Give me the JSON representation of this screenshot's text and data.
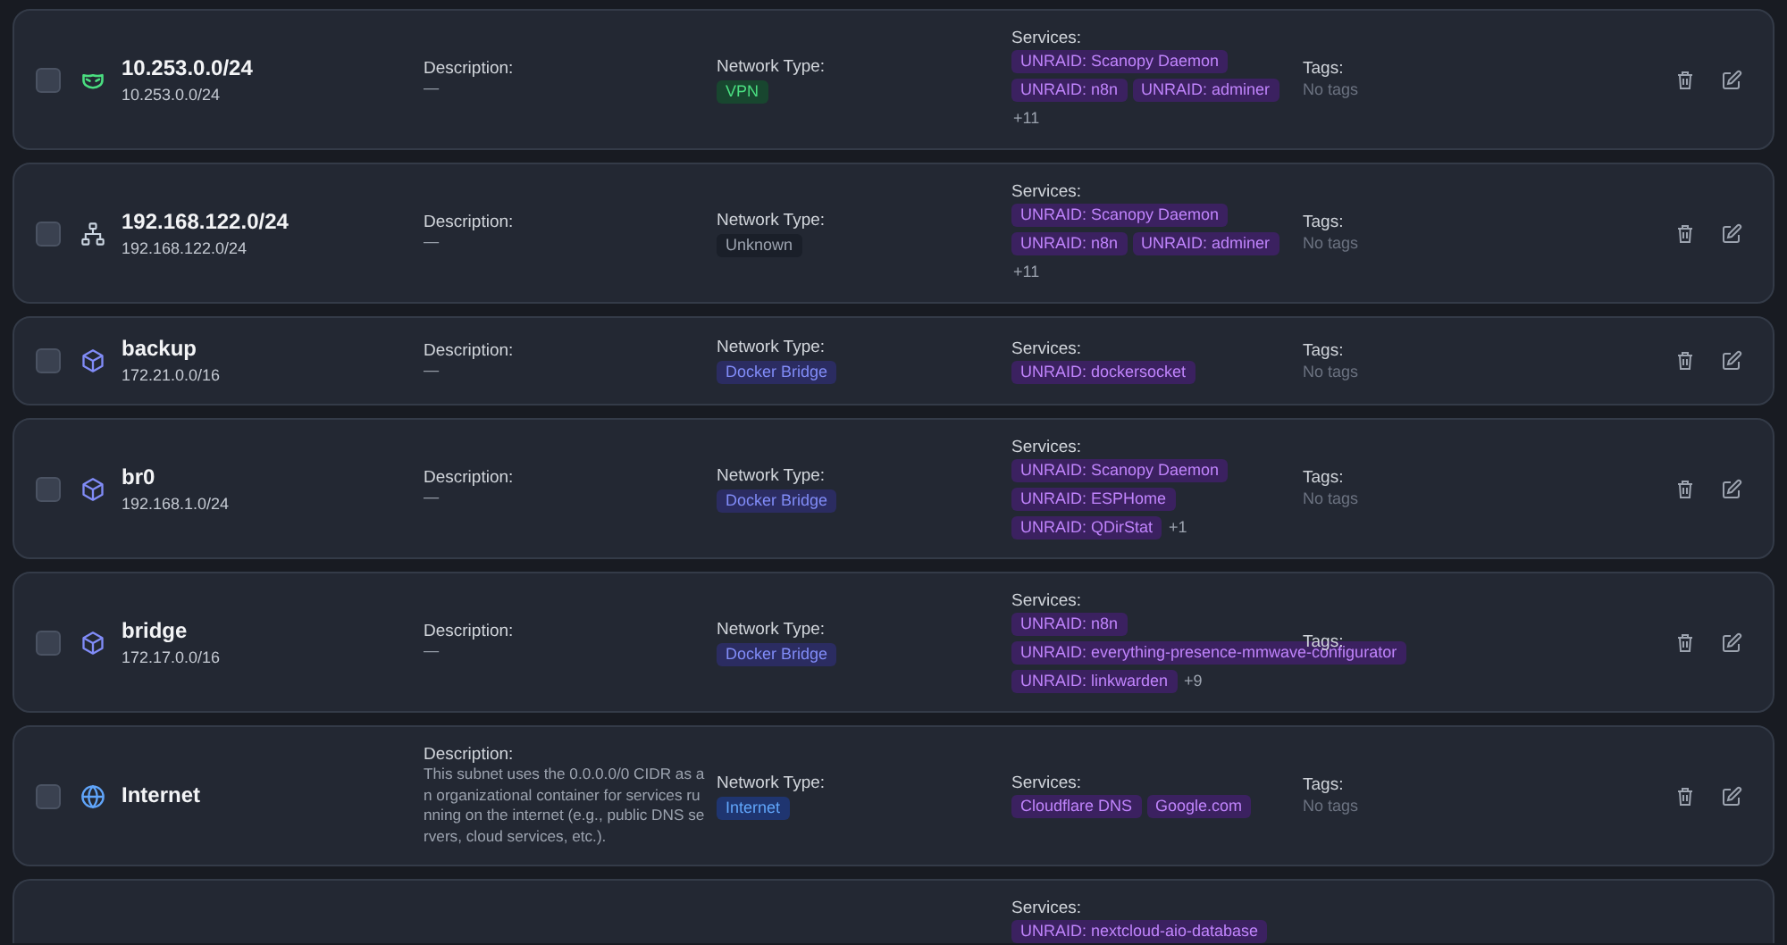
{
  "networks": [
    {
      "name": "10.253.0.0/24",
      "subnet": "10.253.0.0/24",
      "checked": false,
      "description_label": "Description:",
      "description": "—",
      "type_label": "Network Type:",
      "network_type": {
        "label": "VPN",
        "kind": "vpn"
      },
      "services_label": "Services:",
      "services": [
        "UNRAID: Scanopy Daemon",
        "UNRAID: n8n",
        "UNRAID: adminer"
      ],
      "more": "+11",
      "tags_label": "Tags:",
      "tags": "No tags"
    },
    {
      "name": "192.168.122.0/24",
      "subnet": "192.168.122.0/24",
      "checked": false,
      "description_label": "Description:",
      "description": "—",
      "type_label": "Network Type:",
      "network_type": {
        "label": "Unknown",
        "kind": "unknown"
      },
      "services_label": "Services:",
      "services": [
        "UNRAID: Scanopy Daemon",
        "UNRAID: n8n",
        "UNRAID: adminer"
      ],
      "more": "+11",
      "tags_label": "Tags:",
      "tags": "No tags"
    },
    {
      "name": "backup",
      "subnet": "172.21.0.0/16",
      "checked": false,
      "description_label": "Description:",
      "description": "—",
      "type_label": "Network Type:",
      "network_type": {
        "label": "Docker Bridge",
        "kind": "docker"
      },
      "services_label": "Services:",
      "services": [
        "UNRAID: dockersocket"
      ],
      "tags_label": "Tags:",
      "tags": "No tags"
    },
    {
      "name": "br0",
      "subnet": "192.168.1.0/24",
      "checked": false,
      "description_label": "Description:",
      "description": "—",
      "type_label": "Network Type:",
      "network_type": {
        "label": "Docker Bridge",
        "kind": "docker"
      },
      "services_label": "Services:",
      "services": [
        "UNRAID: Scanopy Daemon",
        "UNRAID: ESPHome",
        "UNRAID: QDirStat"
      ],
      "more": "+1",
      "tags_label": "Tags:",
      "tags": "No tags"
    },
    {
      "name": "bridge",
      "subnet": "172.17.0.0/16",
      "checked": false,
      "description_label": "Description:",
      "description": "—",
      "type_label": "Network Type:",
      "network_type": {
        "label": "Docker Bridge",
        "kind": "docker"
      },
      "services_label": "Services:",
      "services": [
        "UNRAID: n8n",
        "UNRAID: everything-presence-mmwave-configurator",
        "UNRAID: linkwarden"
      ],
      "more": "+9",
      "tags_label": "Tags:"
    },
    {
      "name": "Internet",
      "checked": false,
      "description_label": "Description:",
      "description": "This subnet uses the 0.0.0.0/0 CIDR as an organizational container for services running on the internet (e.g., public DNS servers, cloud services, etc.).",
      "type_label": "Network Type:",
      "network_type": {
        "label": "Internet",
        "kind": "internet"
      },
      "services_label": "Services:",
      "services": [
        "Cloudflare DNS",
        "Google.com"
      ],
      "tags_label": "Tags:",
      "tags": "No tags"
    },
    {
      "services_label": "Services:",
      "services": [
        "UNRAID: nextcloud-aio-database"
      ]
    }
  ]
}
